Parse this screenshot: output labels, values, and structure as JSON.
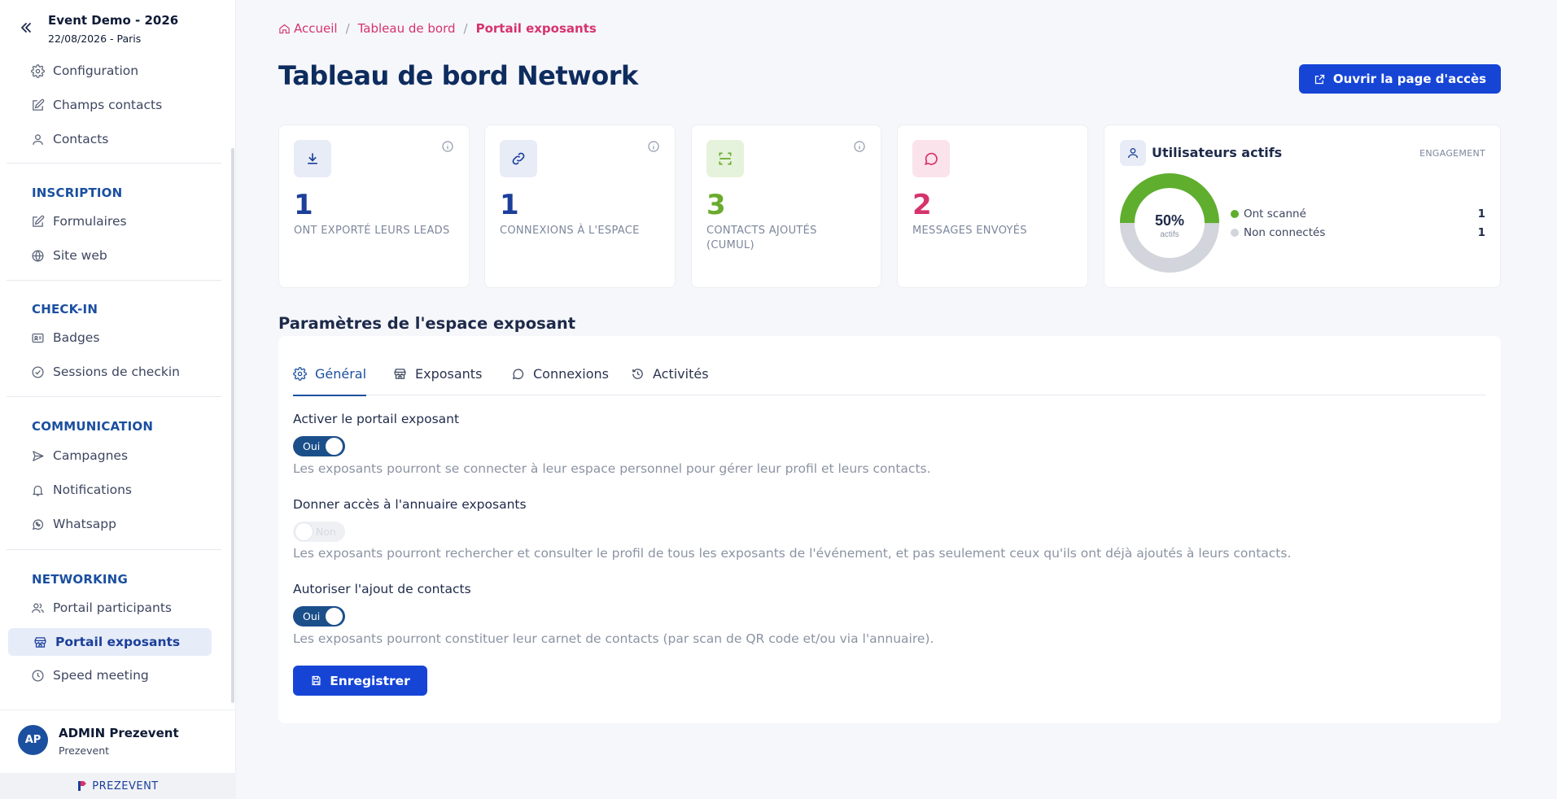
{
  "event": {
    "title": "Event Demo - 2026",
    "subtitle": "22/08/2026 - Paris"
  },
  "sidebar": {
    "top_items": [
      {
        "label": "Configuration",
        "icon": "gear-icon"
      },
      {
        "label": "Champs contacts",
        "icon": "edit-icon"
      },
      {
        "label": "Contacts",
        "icon": "user-icon"
      }
    ],
    "sections": [
      {
        "title": "INSCRIPTION",
        "items": [
          {
            "label": "Formulaires",
            "icon": "edit-icon"
          },
          {
            "label": "Site web",
            "icon": "globe-icon"
          }
        ]
      },
      {
        "title": "CHECK-IN",
        "items": [
          {
            "label": "Badges",
            "icon": "id-card-icon"
          },
          {
            "label": "Sessions de checkin",
            "icon": "check-circle-icon"
          }
        ]
      },
      {
        "title": "COMMUNICATION",
        "items": [
          {
            "label": "Campagnes",
            "icon": "send-icon"
          },
          {
            "label": "Notifications",
            "icon": "bell-icon"
          },
          {
            "label": "Whatsapp",
            "icon": "whatsapp-icon"
          }
        ]
      },
      {
        "title": "NETWORKING",
        "items": [
          {
            "label": "Portail participants",
            "icon": "users-icon"
          },
          {
            "label": "Portail exposants",
            "icon": "store-icon",
            "active": true
          },
          {
            "label": "Speed meeting",
            "icon": "clock-icon"
          }
        ]
      }
    ],
    "user": {
      "initials": "AP",
      "name": "ADMIN Prezevent",
      "org": "Prezevent"
    },
    "brand": "PREZEVENT"
  },
  "breadcrumb": [
    "Accueil",
    "Tableau de bord",
    "Portail exposants"
  ],
  "page_title": "Tableau de bord Network",
  "open_button": "Ouvrir la page d'accès",
  "stats": [
    {
      "value": "1",
      "label": "ONT EXPORTÉ LEURS LEADS",
      "color": "#1b3f9a",
      "icon_bg": "#e8ecf7",
      "icon": "download-icon"
    },
    {
      "value": "1",
      "label": "CONNEXIONS À L'ESPACE",
      "color": "#1b3f9a",
      "icon_bg": "#e8ecf7",
      "icon": "link-icon"
    },
    {
      "value": "3",
      "label": "CONTACTS AJOUTÉS (CUMUL)",
      "color": "#6aab2c",
      "icon_bg": "#e6f3dc",
      "icon": "scan-icon"
    },
    {
      "value": "2",
      "label": "MESSAGES ENVOYÉS",
      "color": "#d6336c",
      "icon_bg": "#fbe3ec",
      "icon": "chat-icon"
    }
  ],
  "engagement": {
    "title": "Utilisateurs actifs",
    "tag": "ENGAGEMENT",
    "percent_label": "50%",
    "sub_label": "actifs",
    "active_fraction": 0.5,
    "legend": [
      {
        "label": "Ont scanné",
        "value": "1",
        "color": "#5fae2e"
      },
      {
        "label": "Non connectés",
        "value": "1",
        "color": "#d2d5db"
      }
    ]
  },
  "settings": {
    "title": "Paramètres de l'espace exposant",
    "tabs": [
      {
        "label": "Général",
        "icon": "gear-icon",
        "active": true
      },
      {
        "label": "Exposants",
        "icon": "store-icon"
      },
      {
        "label": "Connexions",
        "icon": "chat-icon"
      },
      {
        "label": "Activités",
        "icon": "history-icon"
      }
    ],
    "fields": [
      {
        "label": "Activer le portail exposant",
        "state": "Oui",
        "on": true,
        "help": "Les exposants pourront se connecter à leur espace personnel pour gérer leur profil et leurs contacts."
      },
      {
        "label": "Donner accès à l'annuaire exposants",
        "state": "Non",
        "on": false,
        "help": "Les exposants pourront rechercher et consulter le profil de tous les exposants de l'événement, et pas seulement ceux qu'ils ont déjà ajoutés à leurs contacts."
      },
      {
        "label": "Autoriser l'ajout de contacts",
        "state": "Oui",
        "on": true,
        "help": "Les exposants pourront constituer leur carnet de contacts (par scan de QR code et/ou via l'annuaire)."
      }
    ],
    "save_label": "Enregistrer"
  }
}
